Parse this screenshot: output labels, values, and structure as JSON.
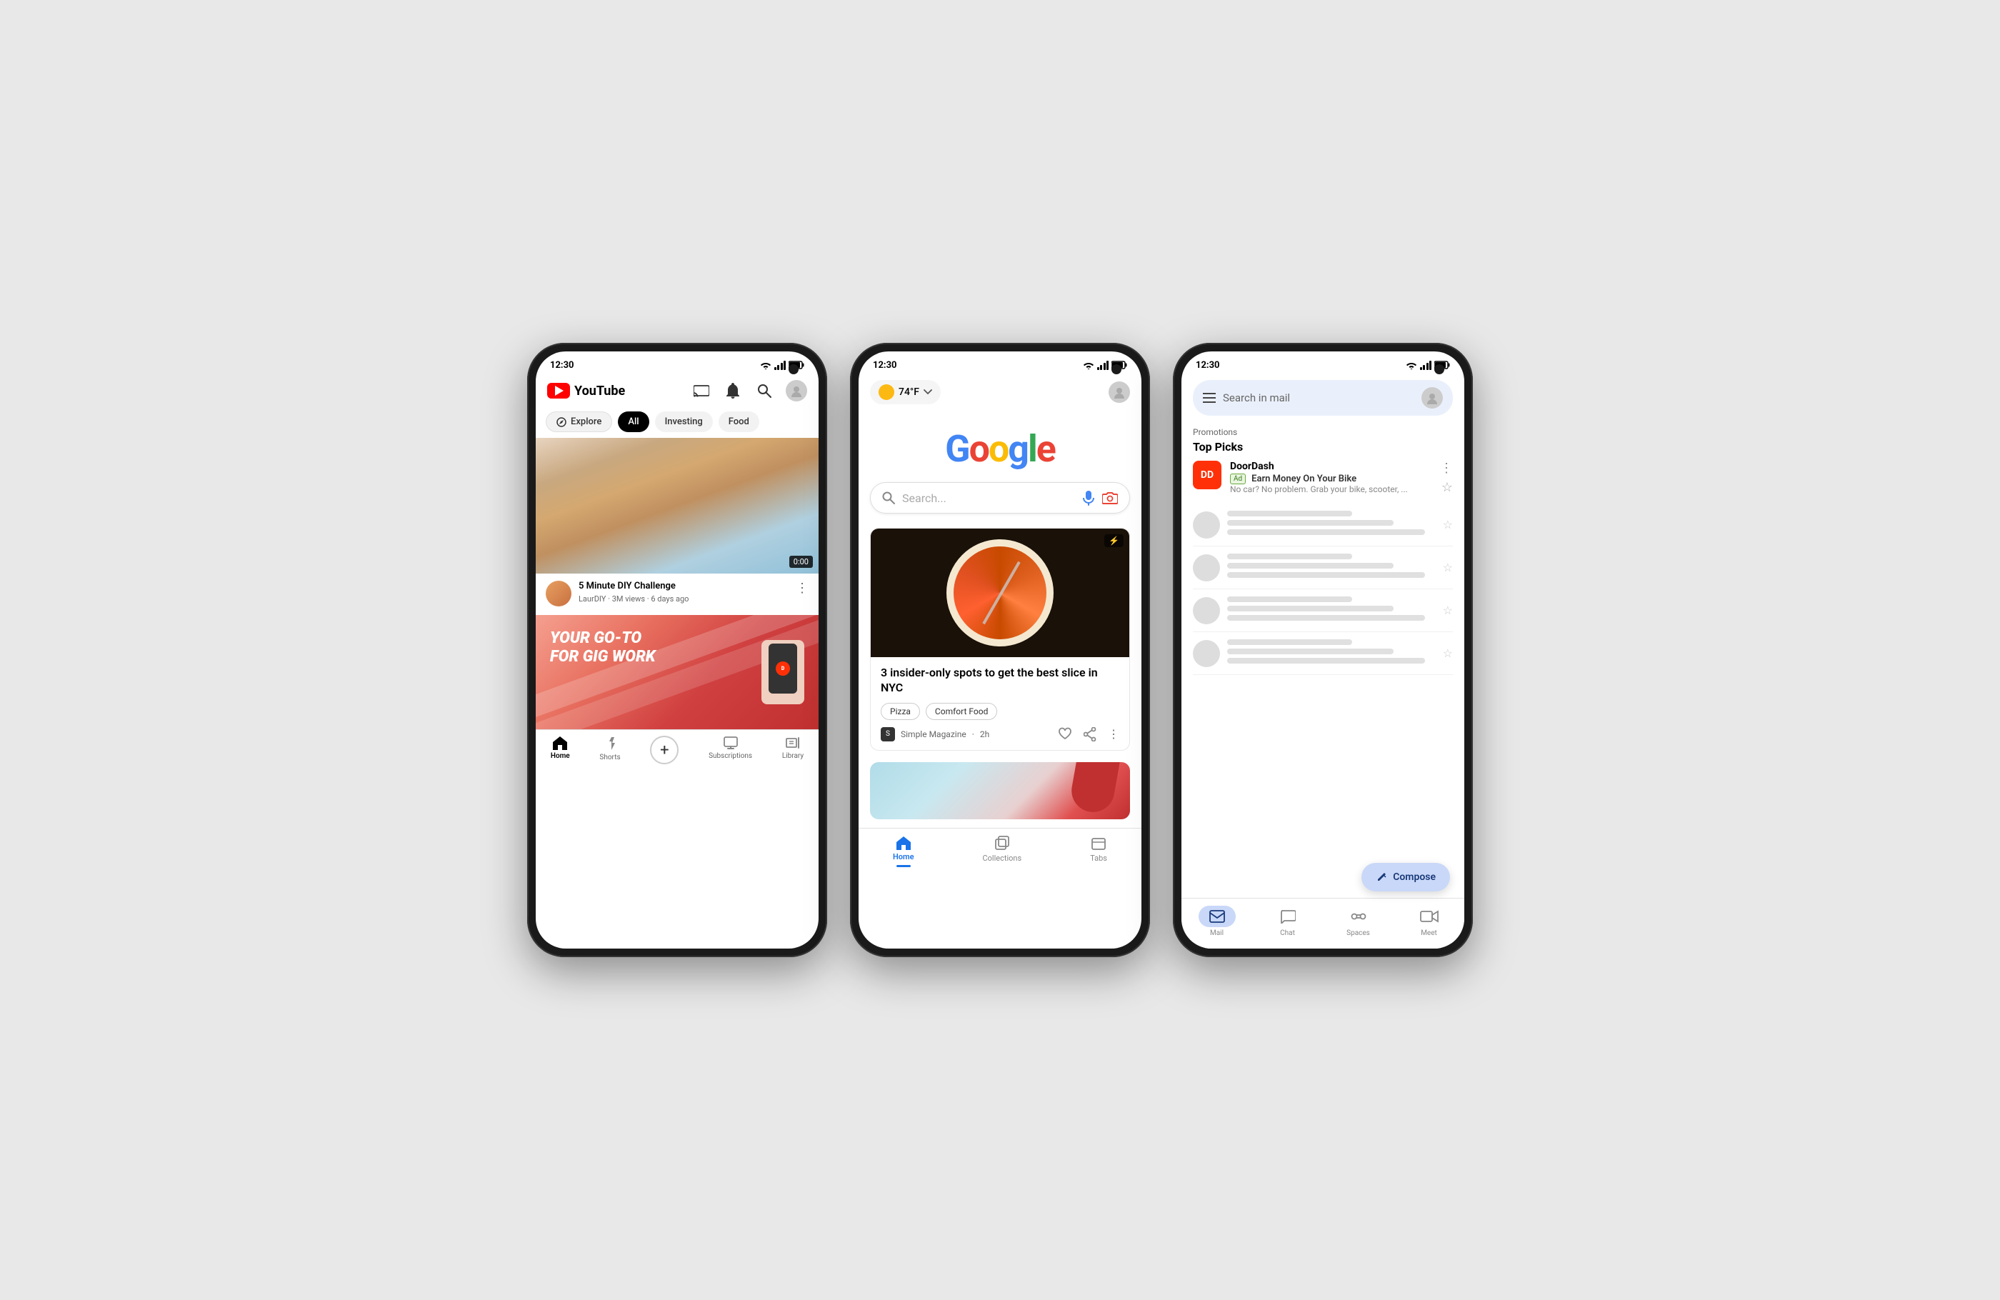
{
  "phones": {
    "youtube": {
      "status": {
        "time": "12:30"
      },
      "header": {
        "logo": "YouTube",
        "icons": [
          "cast",
          "bell",
          "search",
          "account"
        ]
      },
      "filters": [
        "Explore",
        "All",
        "Investing",
        "Food"
      ],
      "video1": {
        "title": "5 Minute DIY Challenge",
        "channel": "LaurDIY",
        "views": "3M views",
        "time": "6 days ago",
        "duration": "0:00"
      },
      "ad": {
        "line1": "YOUR GO-TO",
        "line2": "FOR GIG WORK"
      },
      "bottomNav": [
        "Home",
        "Shorts",
        "+",
        "Subscriptions",
        "Library"
      ]
    },
    "google": {
      "status": {
        "time": "12:30"
      },
      "header": {
        "weather": "74°F",
        "weatherIcon": "sun"
      },
      "logo": {
        "letters": [
          "G",
          "o",
          "o",
          "g",
          "l",
          "e"
        ],
        "colors": [
          "blue",
          "red",
          "yellow",
          "blue",
          "green",
          "red"
        ]
      },
      "search": {
        "placeholder": "Search..."
      },
      "article": {
        "title": "3 insider-only spots to get the best slice in NYC",
        "tags": [
          "Pizza",
          "Comfort Food"
        ],
        "source": "Simple Magazine",
        "time": "2h",
        "flashBadge": "⚡"
      },
      "bottomNav": [
        "Home",
        "Collections",
        "Tabs"
      ]
    },
    "gmail": {
      "status": {
        "time": "12:30"
      },
      "header": {
        "searchPlaceholder": "Search in mail"
      },
      "promotions": "Promotions",
      "topPicks": "Top Picks",
      "featuredEmail": {
        "sender": "DoorDash",
        "adLabel": "Ad",
        "subject": "Earn Money On Your Bike",
        "preview": "No car? No problem. Grab your bike, scooter, ..."
      },
      "compose": "Compose",
      "bottomNav": [
        "Mail",
        "Chat",
        "Spaces",
        "Meet"
      ]
    }
  }
}
